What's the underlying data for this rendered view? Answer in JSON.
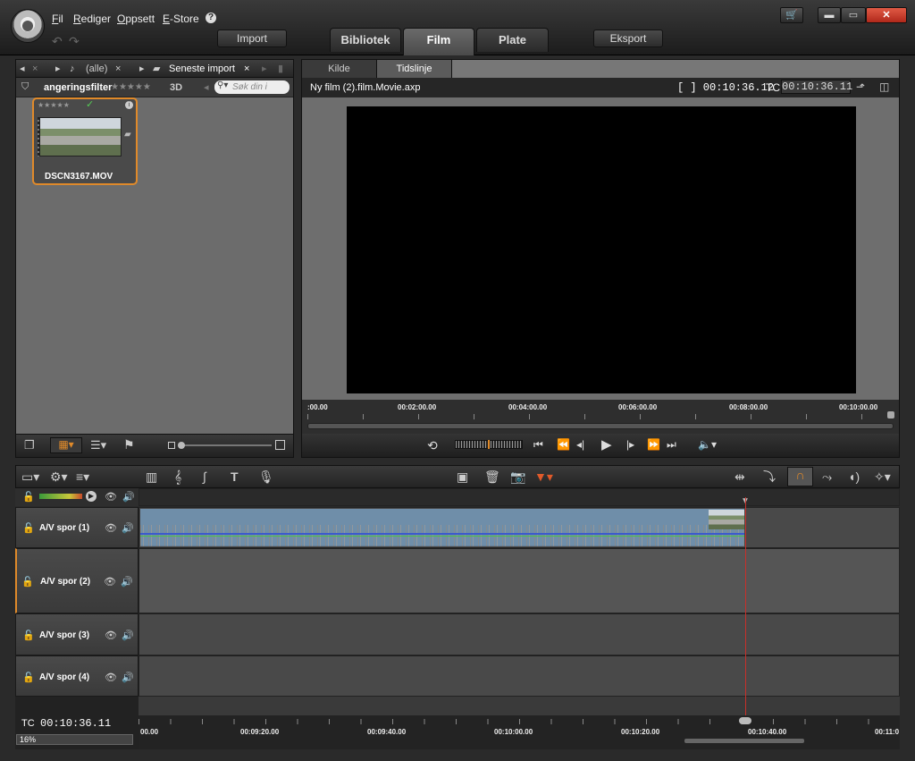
{
  "menu": {
    "file": "Fil",
    "edit": "Rediger",
    "setup": "Oppsett",
    "estore": "E-Store",
    "help": "?"
  },
  "toolbar": {
    "import": "Import",
    "export": "Eksport"
  },
  "main_tabs": [
    {
      "label": "Bibliotek"
    },
    {
      "label": "Film"
    },
    {
      "label": "Plate"
    }
  ],
  "window": {
    "cart": "🛒",
    "minimize": "▬",
    "maximize": "▭",
    "close": "✕"
  },
  "library": {
    "nav": {
      "filter_label": "(alle)",
      "location_label": "Seneste import"
    },
    "rating_filter_label": "angeringsfilter",
    "threed_label": "3D",
    "search_placeholder": "Søk din i",
    "clip": {
      "name": "DSCN3167.MOV"
    }
  },
  "player": {
    "tabs": [
      {
        "label": "Kilde"
      },
      {
        "label": "Tidslinje"
      }
    ],
    "project_name": "Ny film (2).film.Movie.axp",
    "duration": "[ ] 00:10:36.12",
    "tc_label": "TC",
    "tc_value": "00:10:36.11",
    "ruler": [
      ":00.00",
      "00:02:00.00",
      "00:04:00.00",
      "00:06:00.00",
      "00:08:00.00",
      "00:10:00.00"
    ]
  },
  "timeline": {
    "tracks": [
      {
        "label": "A/V spor (1)"
      },
      {
        "label": "A/V spor (2)"
      },
      {
        "label": "A/V spor (3)"
      },
      {
        "label": "A/V spor (4)"
      }
    ],
    "tc_label": "TC",
    "tc_value": "00:10:36.11",
    "zoom": "16%",
    "ruler": [
      "00.00",
      "00:09:20.00",
      "00:09:40.00",
      "00:10:00.00",
      "00:10:20.00",
      "00:10:40.00",
      "00:11:0"
    ]
  },
  "colors": {
    "accent": "#e08a2a",
    "playhead": "#c8302a",
    "clip": "#6f8ea9"
  }
}
